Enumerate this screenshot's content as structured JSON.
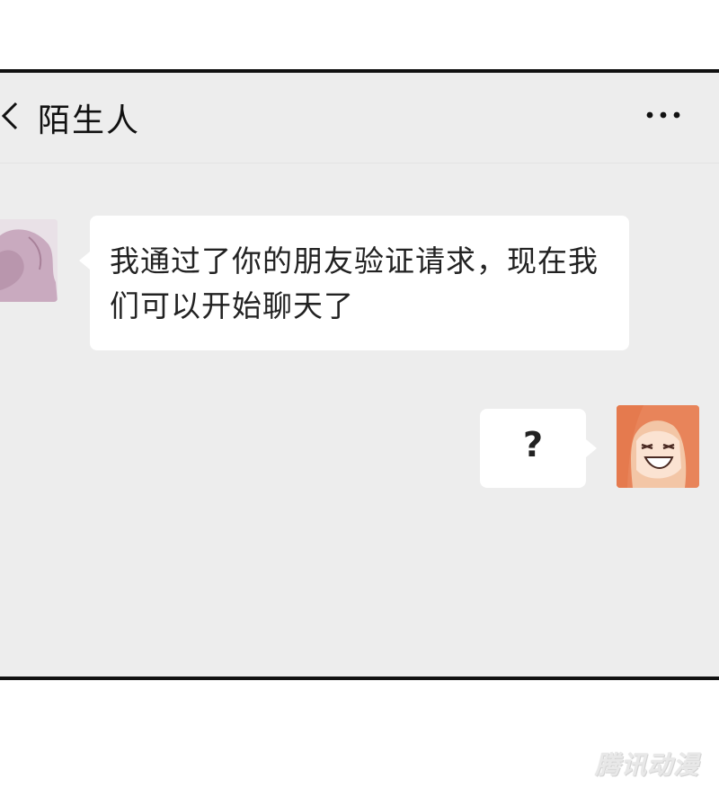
{
  "header": {
    "title": "陌生人",
    "back_icon": "chevron-left-icon",
    "more_icon": "more-horizontal-icon"
  },
  "messages": [
    {
      "side": "left",
      "text": "我通过了你的朋友验证请求，现在我们可以开始聊天了"
    },
    {
      "side": "right",
      "text": "?"
    }
  ],
  "watermark": "腾讯动漫",
  "colors": {
    "chat_background": "#ededed",
    "bubble": "#ffffff",
    "frame_border": "#111111"
  }
}
